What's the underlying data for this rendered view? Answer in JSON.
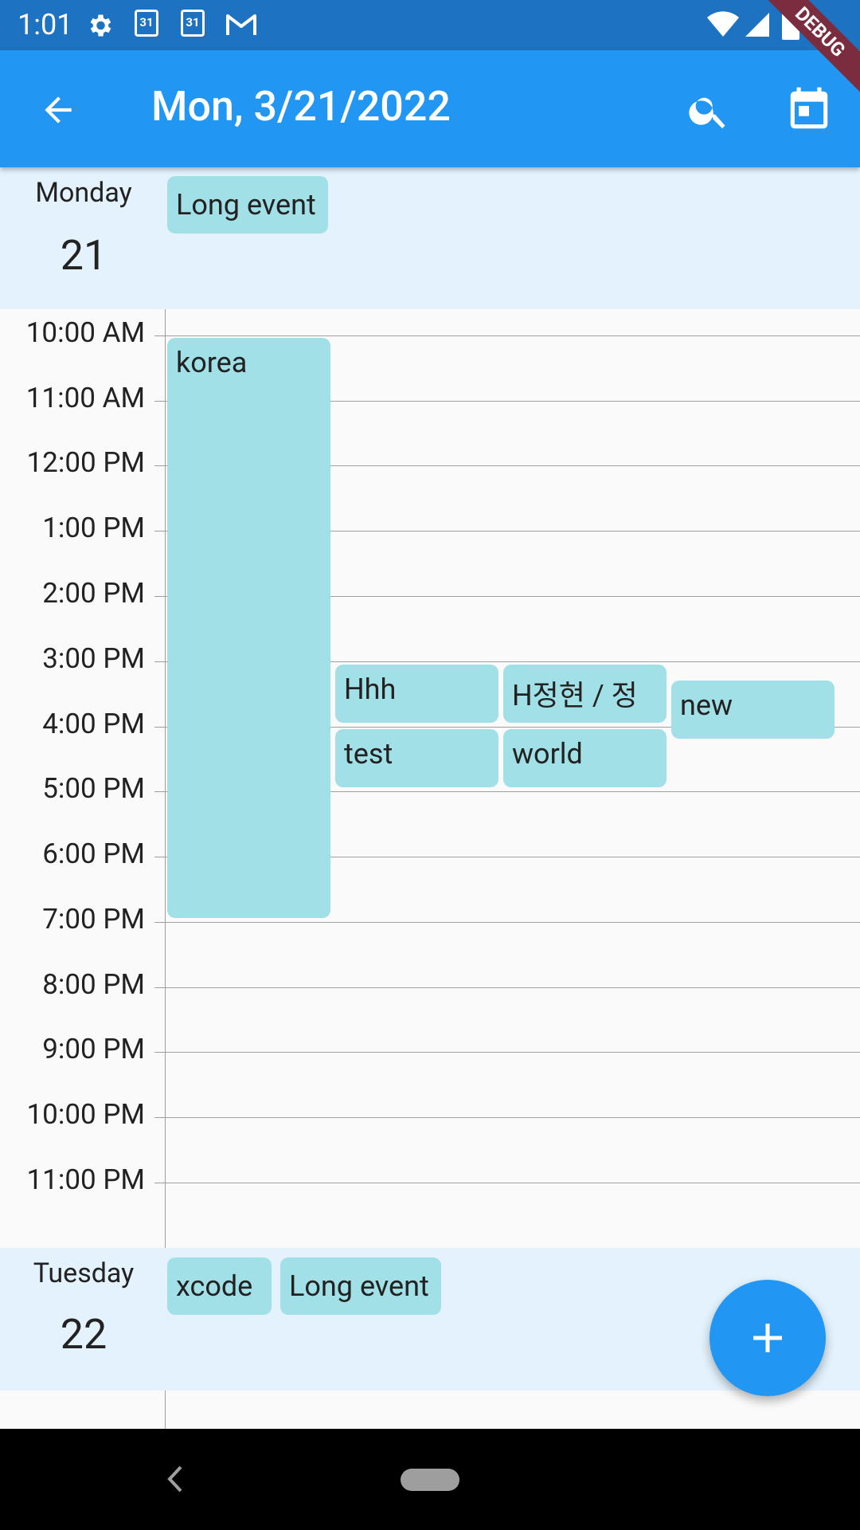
{
  "status_bar": {
    "time": "1:01",
    "calendar_badge_1": "31",
    "calendar_badge_2": "31",
    "icons": [
      "settings-icon",
      "calendar-icon",
      "calendar-icon",
      "gmail-icon",
      "wifi-icon",
      "cell-signal-icon",
      "battery-icon"
    ]
  },
  "debug_banner": "DEBUG",
  "app_bar": {
    "title": "Mon, 3/21/2022",
    "icons": [
      "back-arrow-icon",
      "search-icon",
      "calendar-today-icon"
    ]
  },
  "days": [
    {
      "name": "Monday",
      "number": "21",
      "all_day_events": [
        "Long event"
      ]
    },
    {
      "name": "Tuesday",
      "number": "22",
      "all_day_events": [
        "xcode",
        "Long event"
      ]
    }
  ],
  "hours": [
    "10:00 AM",
    "11:00 AM",
    "12:00 PM",
    "1:00 PM",
    "2:00 PM",
    "3:00 PM",
    "4:00 PM",
    "5:00 PM",
    "6:00 PM",
    "7:00 PM",
    "8:00 PM",
    "9:00 PM",
    "10:00 PM",
    "11:00 PM"
  ],
  "events": [
    {
      "title": "korea"
    },
    {
      "title": "Hhh"
    },
    {
      "title": "H정현 / 정"
    },
    {
      "title": "new"
    },
    {
      "title": "test"
    },
    {
      "title": "world"
    }
  ],
  "fab": {
    "icon": "add-icon"
  },
  "nav_bar": {
    "icons": [
      "nav-back-icon",
      "nav-home-pill"
    ]
  },
  "colors": {
    "app_bar": "#2196f3",
    "status_bar": "#1d72c2",
    "day_header_bg": "#e3f2fd",
    "event_bg": "#a2e0e7",
    "debug_banner": "#7b2c3f"
  }
}
